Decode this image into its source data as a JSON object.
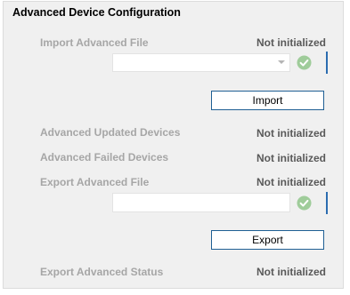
{
  "section": {
    "title": "Advanced Device Configuration"
  },
  "import_file": {
    "label": "Import Advanced File",
    "status": "Not initialized",
    "selected": ""
  },
  "import_button": {
    "label": "Import"
  },
  "updated_devices": {
    "label": "Advanced Updated Devices",
    "status": "Not initialized"
  },
  "failed_devices": {
    "label": "Advanced Failed Devices",
    "status": "Not initialized"
  },
  "export_file": {
    "label": "Export Advanced File",
    "status": "Not initialized",
    "value": ""
  },
  "export_button": {
    "label": "Export"
  },
  "export_status": {
    "label": "Export Advanced Status",
    "status": "Not initialized"
  },
  "icons": {
    "check": "check-circle-icon",
    "dropdown": "chevron-down-icon"
  },
  "colors": {
    "check": "#9fcc9a",
    "accent": "#1f5f94",
    "label_disabled": "#a6a6a6",
    "value": "#595959"
  }
}
